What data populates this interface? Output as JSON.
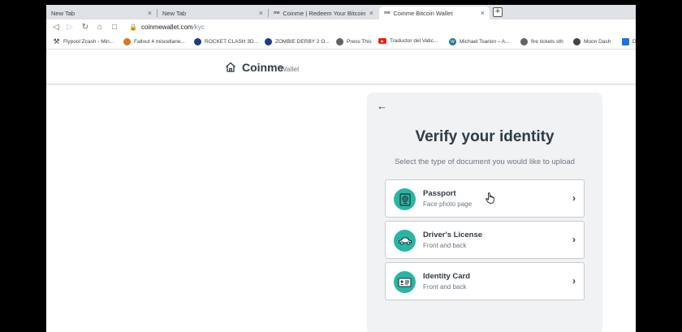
{
  "tabs": [
    {
      "label": "New Tab",
      "favicon": "",
      "active": false
    },
    {
      "label": "New Tab",
      "favicon": "",
      "active": false
    },
    {
      "label": "Coinme | Redeem Your Bitcoin | Bi",
      "favicon": "me",
      "active": false
    },
    {
      "label": "Coinme Bitcoin Wallet",
      "favicon": "me",
      "active": true
    }
  ],
  "address": {
    "domain": "coinmewallet.com",
    "path": "/kyc"
  },
  "bookmarks": [
    {
      "label": "Flypool Zcash - Min...",
      "icon": "pickaxe-icon",
      "color": "#3c4043"
    },
    {
      "label": "Fallout 4 miscellane...",
      "icon": "fallout-icon",
      "color": "#d67a1a"
    },
    {
      "label": "ROCKET CLASH 3D...",
      "icon": "game-icon",
      "color": "#1e3a8a"
    },
    {
      "label": "ZOMBIE DERBY 2 O...",
      "icon": "game-icon",
      "color": "#1e3a8a"
    },
    {
      "label": "Press This",
      "icon": "globe-icon",
      "color": "#5f6368"
    },
    {
      "label": "Traductor del Vatic...",
      "icon": "youtube-icon",
      "color": "#e62117"
    },
    {
      "label": "Michael Tsarion – A...",
      "icon": "wordpress-icon",
      "color": "#21759b"
    },
    {
      "label": "fire tickets sth",
      "icon": "globe-icon",
      "color": "#5f6368"
    },
    {
      "label": "Moon Dash",
      "icon": "moon-icon",
      "color": "#444"
    },
    {
      "label": "D",
      "icon": "folder-icon",
      "color": "#1a73e8"
    }
  ],
  "site": {
    "brand": "Coinme",
    "brand_sub": "Wallet"
  },
  "verify": {
    "title": "Verify your identity",
    "subtitle": "Select the type of document you would like to upload",
    "options": [
      {
        "title": "Passport",
        "description": "Face photo page",
        "icon": "passport-icon"
      },
      {
        "title": "Driver's License",
        "description": "Front and back",
        "icon": "car-icon"
      },
      {
        "title": "Identity Card",
        "description": "Front and back",
        "icon": "id-card-icon"
      }
    ]
  },
  "colors": {
    "accent": "#27b6a4",
    "text": "#2f3b46",
    "muted": "#6b7680",
    "card_bg": "#f1f2f4"
  }
}
